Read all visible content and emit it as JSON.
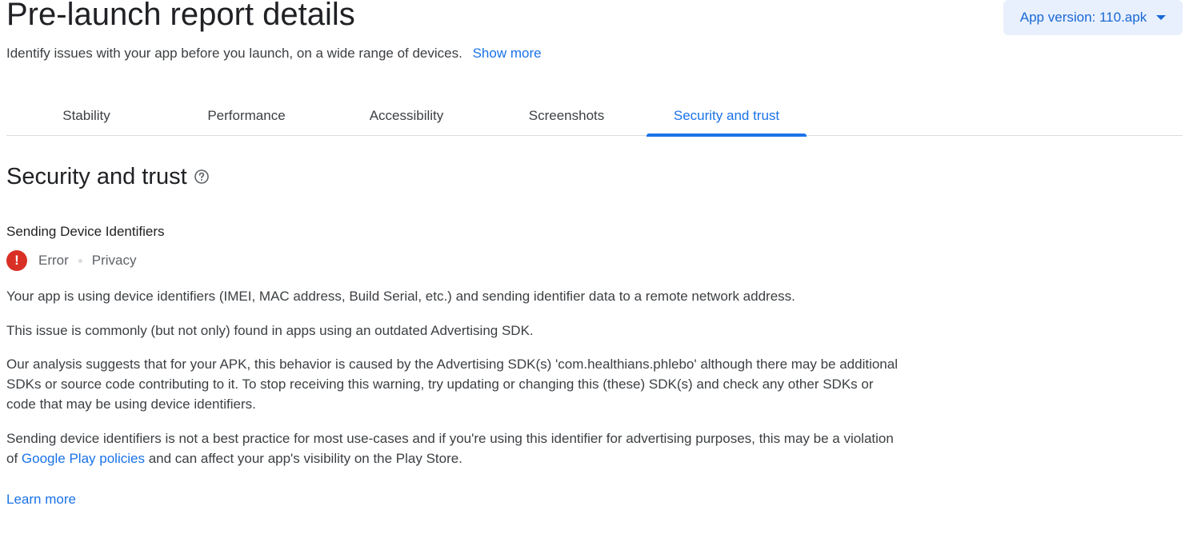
{
  "header": {
    "title": "Pre-launch report details",
    "subtitle": "Identify issues with your app before you launch, on a wide range of devices.",
    "show_more": "Show more",
    "version_button": "App version: 110.apk"
  },
  "tabs": [
    {
      "label": "Stability"
    },
    {
      "label": "Performance"
    },
    {
      "label": "Accessibility"
    },
    {
      "label": "Screenshots"
    },
    {
      "label": "Security and trust",
      "active": true
    }
  ],
  "section": {
    "title": "Security and trust",
    "help_icon": "help-circle-icon"
  },
  "issue": {
    "title": "Sending Device Identifiers",
    "severity_icon": "error-icon",
    "severity": "Error",
    "category": "Privacy",
    "paragraph1": "Your app is using device identifiers (IMEI, MAC address, Build Serial, etc.) and sending identifier data to a remote network address.",
    "paragraph2": "This issue is commonly (but not only) found in apps using an outdated Advertising SDK.",
    "paragraph3": "Our analysis suggests that for your APK, this behavior is caused by the Advertising SDK(s) 'com.healthians.phlebo' although there may be additional SDKs or source code contributing to it. To stop receiving this warning, try updating or changing this (these) SDK(s) and check any other SDKs or code that may be using device identifiers.",
    "paragraph4_before": "Sending device identifiers is not a best practice for most use-cases and if you're using this identifier for advertising purposes, this may be a violation of",
    "paragraph4_link": "Google Play policies",
    "paragraph4_after": "and can affect your app's visibility on the Play Store.",
    "learn_more": "Learn more"
  },
  "colors": {
    "accent": "#1a73e8",
    "error": "#d93025",
    "version_bg": "#e8f0fe"
  }
}
